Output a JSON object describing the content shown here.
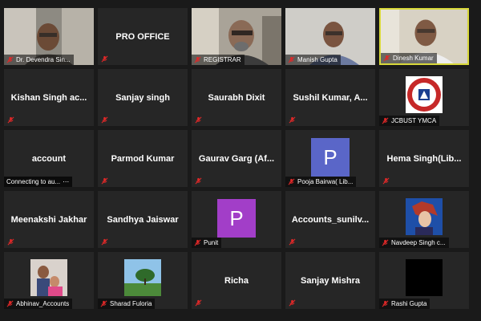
{
  "participants": [
    {
      "name": "Dr. Devendra Sin...",
      "has_video": true
    },
    {
      "name": "PRO OFFICE",
      "has_video": false
    },
    {
      "name": "REGISTRAR",
      "has_video": true
    },
    {
      "name": "Manish Gupta",
      "has_video": true
    },
    {
      "name": "Dinesh Kumar",
      "has_video": true,
      "active_speaker": true
    },
    {
      "name": "Kishan Singh ac...",
      "has_video": false
    },
    {
      "name": "Sanjay singh",
      "has_video": false
    },
    {
      "name": "Saurabh Dixit",
      "has_video": false
    },
    {
      "name": "Sushil Kumar, A...",
      "has_video": false
    },
    {
      "name": "JCBUST YMCA",
      "has_video": false,
      "has_logo": true
    },
    {
      "name": "account",
      "status": "Connecting to au..."
    },
    {
      "name": "Parmod Kumar",
      "has_video": false
    },
    {
      "name": "Gaurav Garg (Af...",
      "has_video": false
    },
    {
      "name": "Pooja Bairwa( Lib...",
      "avatar_letter": "P",
      "avatar_color": "#5a66c8"
    },
    {
      "name": "Hema Singh(Lib...",
      "has_video": false
    },
    {
      "name": "Meenakshi Jakhar",
      "has_video": false
    },
    {
      "name": "Sandhya Jaiswar",
      "has_video": false
    },
    {
      "name": "Punit",
      "avatar_letter": "P",
      "avatar_color": "#a23ec8"
    },
    {
      "name": "Accounts_sunilv...",
      "has_video": false
    },
    {
      "name": "Navdeep Singh c...",
      "has_photo": true
    },
    {
      "name": "Abhinav_Accounts",
      "has_photo": true
    },
    {
      "name": "Sharad Fuloria",
      "has_photo": true
    },
    {
      "name": "Richa",
      "has_video": false
    },
    {
      "name": "Sanjay Mishra",
      "has_video": false
    },
    {
      "name": "Rashi Gupta",
      "has_photo": true
    }
  ],
  "colors": {
    "background": "#1a1a1a",
    "tile": "#262626",
    "muted_mic": "#e02828",
    "active_border": "#d8d83a"
  }
}
